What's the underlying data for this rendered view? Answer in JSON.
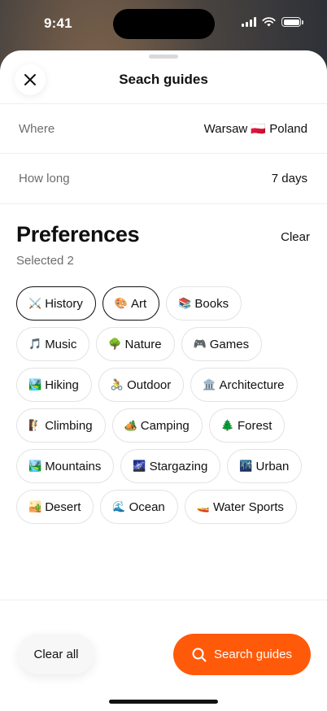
{
  "status_bar": {
    "time": "9:41"
  },
  "sheet": {
    "title": "Seach guides",
    "close_icon": "close-icon"
  },
  "trip": {
    "where": {
      "label": "Where",
      "value": "Warsaw 🇵🇱 Poland"
    },
    "how_long": {
      "label": "How long",
      "value": "7 days"
    }
  },
  "preferences": {
    "title": "Preferences",
    "clear_label": "Clear",
    "selected_text": "Selected 2",
    "chips": [
      {
        "emoji": "⚔️",
        "label": "History",
        "selected": true
      },
      {
        "emoji": "🎨",
        "label": "Art",
        "selected": true
      },
      {
        "emoji": "📚",
        "label": "Books",
        "selected": false
      },
      {
        "emoji": "🎵",
        "label": "Music",
        "selected": false
      },
      {
        "emoji": "🌳",
        "label": "Nature",
        "selected": false
      },
      {
        "emoji": "🎮",
        "label": "Games",
        "selected": false
      },
      {
        "emoji": "🏞️",
        "label": "Hiking",
        "selected": false
      },
      {
        "emoji": "🚴",
        "label": "Outdoor",
        "selected": false
      },
      {
        "emoji": "🏛️",
        "label": "Architecture",
        "selected": false
      },
      {
        "emoji": "🧗",
        "label": "Climbing",
        "selected": false
      },
      {
        "emoji": "🏕️",
        "label": "Camping",
        "selected": false
      },
      {
        "emoji": "🌲",
        "label": "Forest",
        "selected": false
      },
      {
        "emoji": "🏞️",
        "label": "Mountains",
        "selected": false
      },
      {
        "emoji": "🌌",
        "label": "Stargazing",
        "selected": false
      },
      {
        "emoji": "🌃",
        "label": "Urban",
        "selected": false
      },
      {
        "emoji": "🏜️",
        "label": "Desert",
        "selected": false
      },
      {
        "emoji": "🌊",
        "label": "Ocean",
        "selected": false
      },
      {
        "emoji": "🚤",
        "label": "Water Sports",
        "selected": false
      }
    ]
  },
  "footer": {
    "clear_all_label": "Clear all",
    "search_label": "Search guides",
    "search_icon": "search-icon",
    "accent_color": "#ff5a0a"
  }
}
